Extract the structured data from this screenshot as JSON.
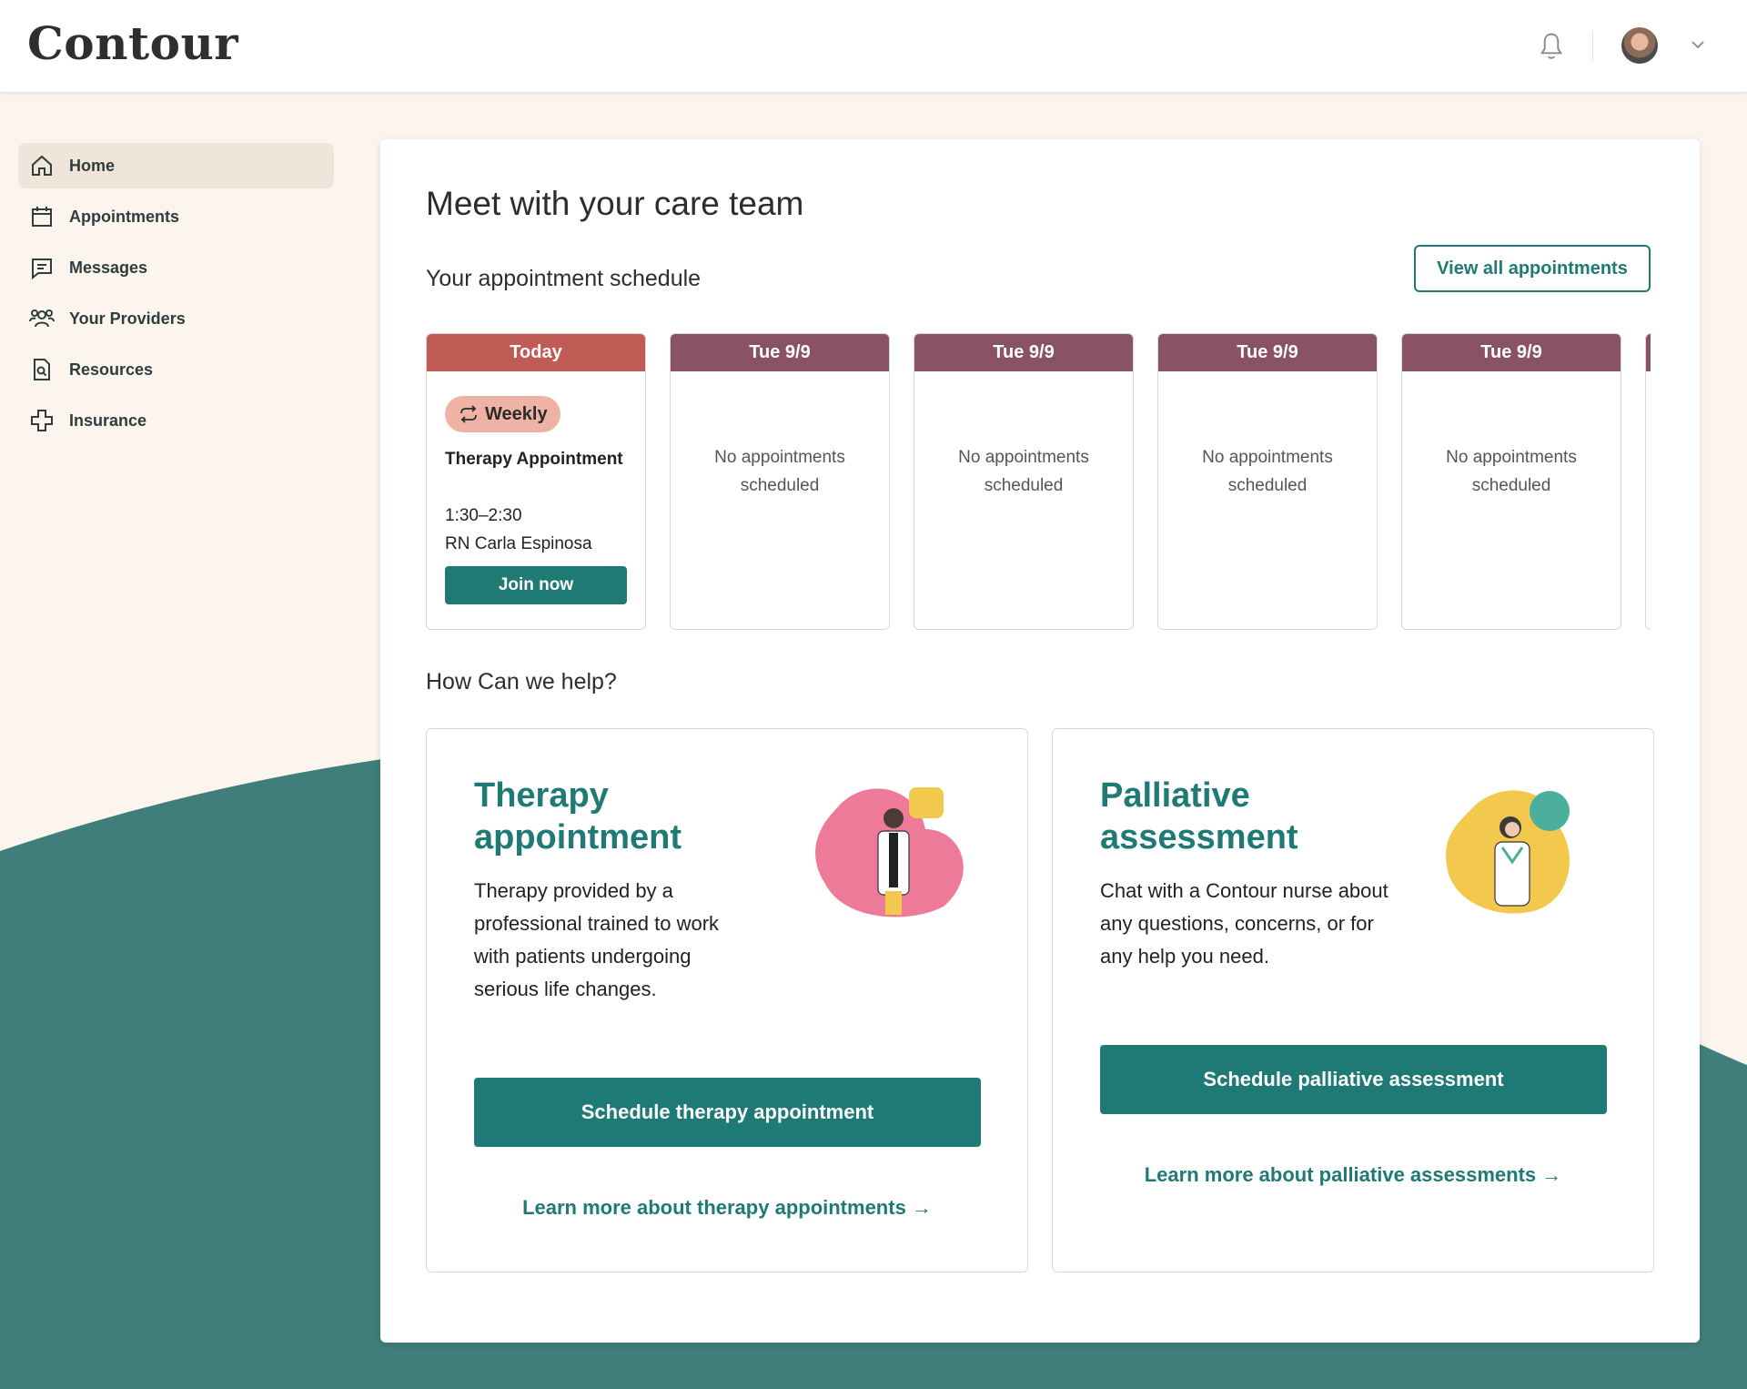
{
  "app": {
    "logo": "Contour"
  },
  "sidebar": {
    "items": [
      {
        "label": "Home",
        "icon": "home-icon",
        "active": true
      },
      {
        "label": "Appointments",
        "icon": "calendar-icon"
      },
      {
        "label": "Messages",
        "icon": "message-icon"
      },
      {
        "label": "Your Providers",
        "icon": "users-icon"
      },
      {
        "label": "Resources",
        "icon": "document-search-icon"
      },
      {
        "label": "Insurance",
        "icon": "medical-cross-icon"
      }
    ]
  },
  "main": {
    "title": "Meet with your care team",
    "schedule_heading": "Your appointment schedule",
    "view_all_label": "View all appointments",
    "days": [
      {
        "header": "Today",
        "badge": "Weekly",
        "appointment_title": "Therapy Appointment",
        "time": "1:30–2:30",
        "provider": "RN Carla Espinosa",
        "join_label": "Join now"
      },
      {
        "header": "Tue 9/9",
        "empty_text": "No appointments scheduled"
      },
      {
        "header": "Tue 9/9",
        "empty_text": "No appointments scheduled"
      },
      {
        "header": "Tue 9/9",
        "empty_text": "No appointments scheduled"
      },
      {
        "header": "Tue 9/9",
        "empty_text": "No appointments scheduled"
      }
    ],
    "help_heading": "How Can we help?",
    "help_cards": [
      {
        "title": "Therapy appointment",
        "description": "Therapy provided by a professional trained to work with patients undergoing serious life changes.",
        "button_label": "Schedule therapy appointment",
        "link_label": "Learn more about therapy appointments →"
      },
      {
        "title": "Palliative assessment",
        "description": "Chat with a Contour nurse about any questions, concerns, or for any help you need.",
        "button_label": "Schedule palliative assessment",
        "link_label": "Learn more about palliative assessments →"
      }
    ]
  },
  "colors": {
    "accent": "#1f7a76",
    "today_header": "#c05a54",
    "day_header": "#8a5363",
    "badge": "#eeb3a5",
    "background": "#fbf5ee",
    "wave": "#3f7e7a"
  }
}
